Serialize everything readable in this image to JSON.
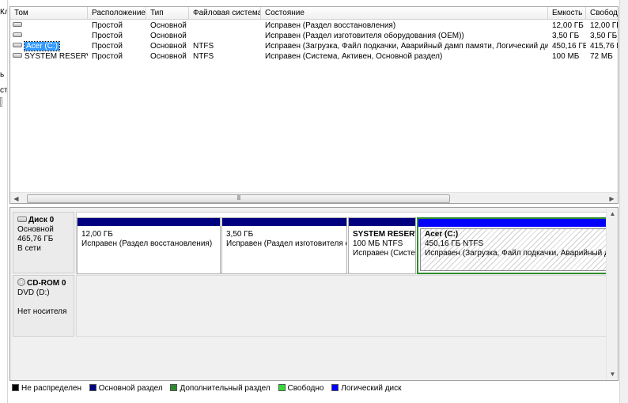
{
  "volume_list": {
    "columns": [
      "Том",
      "Расположение",
      "Тип",
      "Файловая система",
      "Состояние",
      "Емкость",
      "Свобод"
    ],
    "rows": [
      {
        "name": "",
        "layout": "Простой",
        "type": "Основной",
        "fs": "",
        "status": "Исправен (Раздел восстановления)",
        "capacity": "12,00 ГБ",
        "free": "12,00 ГБ"
      },
      {
        "name": "",
        "layout": "Простой",
        "type": "Основной",
        "fs": "",
        "status": "Исправен (Раздел изготовителя оборудования (OEM))",
        "capacity": "3,50 ГБ",
        "free": "3,50 ГБ"
      },
      {
        "name": "Acer (C:)",
        "layout": "Простой",
        "type": "Основной",
        "fs": "NTFS",
        "status": "Исправен (Загрузка, Файл подкачки, Аварийный дамп памяти, Логический диск)",
        "capacity": "450,16 ГБ",
        "free": "415,76 Г"
      },
      {
        "name": "SYSTEM RESERVED",
        "layout": "Простой",
        "type": "Основной",
        "fs": "NTFS",
        "status": "Исправен (Система, Активен, Основной раздел)",
        "capacity": "100 МБ",
        "free": "72 МБ"
      }
    ],
    "scroll_thumb_grip": "III"
  },
  "left_strip": [
    "Кл",
    "ь",
    "ст"
  ],
  "disk0": {
    "title": "Диск 0",
    "type": "Основной",
    "size": "465,76 ГБ",
    "state": "В сети",
    "partitions": [
      {
        "name": "",
        "size": "12,00 ГБ",
        "status": "Исправен (Раздел восстановления)"
      },
      {
        "name": "",
        "size": "3,50 ГБ",
        "status": "Исправен (Раздел изготовителя о"
      },
      {
        "name": "SYSTEM RESERVE",
        "size": "100 МБ NTFS",
        "status": "Исправен (Систе"
      },
      {
        "name": "Acer  (C:)",
        "size": "450,16 ГБ NTFS",
        "status": "Исправен (Загрузка, Файл подкачки, Аварийный дамп"
      }
    ]
  },
  "cdrom0": {
    "title": "CD-ROM 0",
    "type": "DVD (D:)",
    "state": "Нет носителя"
  },
  "legend": [
    {
      "label": "Не распределен",
      "color": "#000000"
    },
    {
      "label": "Основной раздел",
      "color": "#000080"
    },
    {
      "label": "Дополнительный раздел",
      "color": "#2e8b2e"
    },
    {
      "label": "Свободно",
      "color": "#33dd33"
    },
    {
      "label": "Логический диск",
      "color": "#0000ff"
    }
  ]
}
